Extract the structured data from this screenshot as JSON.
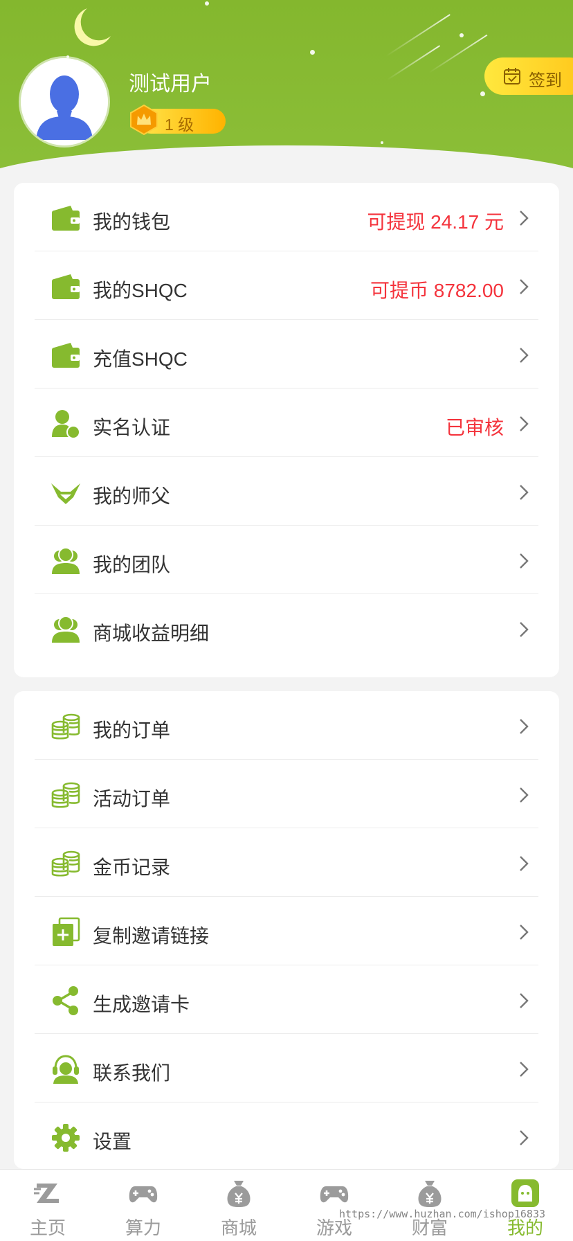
{
  "colors": {
    "accent": "#86ba2f",
    "value_red": "#f4333c",
    "tab_inactive": "#9b9b9b"
  },
  "profile": {
    "username": "测试用户",
    "level": "1 级",
    "signin_label": "签到"
  },
  "menu_primary": [
    {
      "icon": "wallet-icon",
      "label": "我的钱包",
      "value": "可提现 24.17 元"
    },
    {
      "icon": "wallet-icon",
      "label": "我的SHQC",
      "value": "可提币 8782.00"
    },
    {
      "icon": "wallet-icon",
      "label": "充值SHQC",
      "value": ""
    },
    {
      "icon": "user-verify-icon",
      "label": "实名认证",
      "value": "已审核"
    },
    {
      "icon": "mentor-icon",
      "label": "我的师父",
      "value": ""
    },
    {
      "icon": "team-icon",
      "label": "我的团队",
      "value": ""
    },
    {
      "icon": "team-icon",
      "label": "商城收益明细",
      "value": ""
    }
  ],
  "menu_secondary": [
    {
      "icon": "coins-icon",
      "label": "我的订单"
    },
    {
      "icon": "coins-icon",
      "label": "活动订单"
    },
    {
      "icon": "coins-icon",
      "label": "金币记录"
    },
    {
      "icon": "copy-link-icon",
      "label": "复制邀请链接"
    },
    {
      "icon": "share-icon",
      "label": "生成邀请卡"
    },
    {
      "icon": "support-icon",
      "label": "联系我们"
    },
    {
      "icon": "settings-icon",
      "label": "设置"
    }
  ],
  "tabs": [
    {
      "icon": "home-z-icon",
      "label": "主页",
      "active": false
    },
    {
      "icon": "gamepad-icon",
      "label": "算力",
      "active": false
    },
    {
      "icon": "money-bag-icon",
      "label": "商城",
      "active": false
    },
    {
      "icon": "gamepad-icon",
      "label": "游戏",
      "active": false
    },
    {
      "icon": "money-bag-icon",
      "label": "财富",
      "active": false
    },
    {
      "icon": "profile-face-icon",
      "label": "我的",
      "active": true
    }
  ],
  "watermark": "https://www.huzhan.com/ishop16833"
}
